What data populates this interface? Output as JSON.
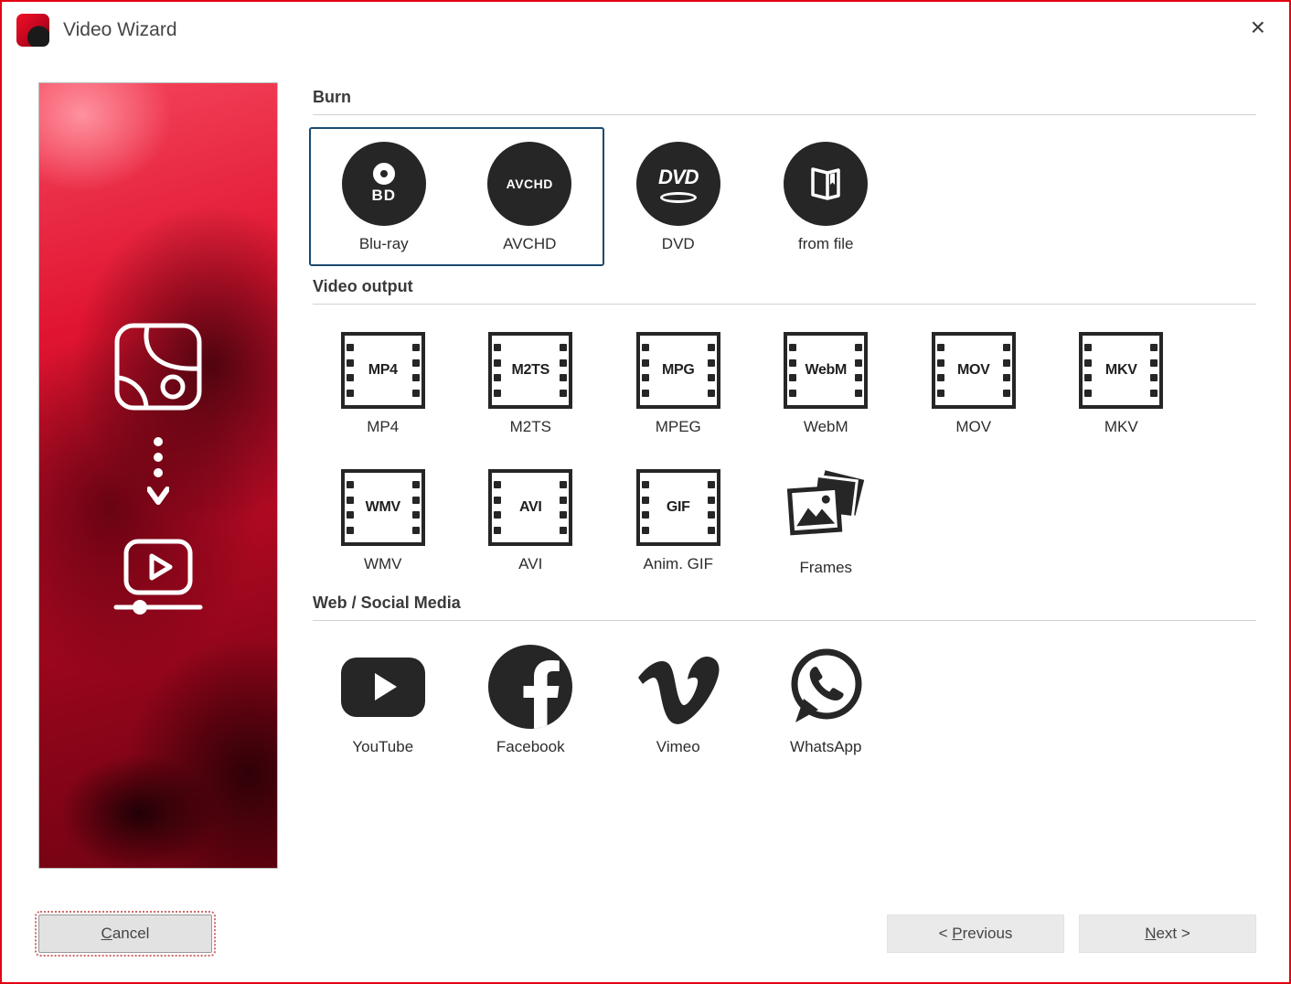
{
  "window": {
    "title": "Video Wizard",
    "close_glyph": "×"
  },
  "sections": {
    "burn": {
      "label": "Burn",
      "items": [
        {
          "caption": "Blu-ray",
          "icon_label": "BD",
          "selected": true
        },
        {
          "caption": "AVCHD",
          "icon_label": "AVCHD",
          "selected": true
        },
        {
          "caption": "DVD",
          "icon_label": "DVD",
          "selected": false
        },
        {
          "caption": "from file",
          "selected": false
        }
      ]
    },
    "video_output": {
      "label": "Video output",
      "row1": [
        {
          "icon_label": "MP4",
          "caption": "MP4"
        },
        {
          "icon_label": "M2TS",
          "caption": "M2TS"
        },
        {
          "icon_label": "MPG",
          "caption": "MPEG"
        },
        {
          "icon_label": "WebM",
          "caption": "WebM"
        },
        {
          "icon_label": "MOV",
          "caption": "MOV"
        },
        {
          "icon_label": "MKV",
          "caption": "MKV"
        }
      ],
      "row2": [
        {
          "icon_label": "WMV",
          "caption": "WMV"
        },
        {
          "icon_label": "AVI",
          "caption": "AVI"
        },
        {
          "icon_label": "GIF",
          "caption": "Anim. GIF"
        },
        {
          "caption": "Frames"
        }
      ]
    },
    "web": {
      "label": "Web / Social Media",
      "items": [
        {
          "caption": "YouTube"
        },
        {
          "caption": "Facebook"
        },
        {
          "caption": "Vimeo"
        },
        {
          "caption": "WhatsApp"
        }
      ]
    }
  },
  "footer": {
    "cancel": {
      "mnemonic": "C",
      "rest": "ancel"
    },
    "previous": {
      "prefix": "< ",
      "mnemonic": "P",
      "rest": "revious"
    },
    "next": {
      "mnemonic": "N",
      "rest": "ext >"
    }
  },
  "colors": {
    "window_border": "#e30015",
    "selection_border": "#1a4a70",
    "icon_dark": "#262626"
  }
}
